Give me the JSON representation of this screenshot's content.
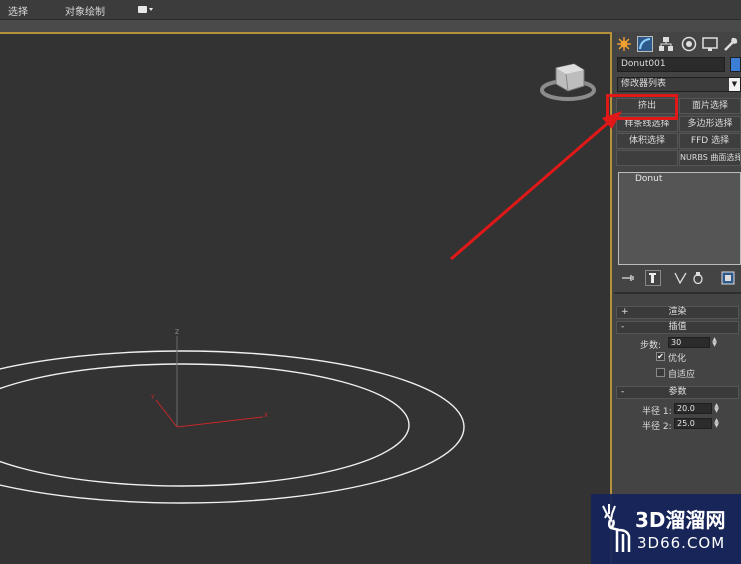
{
  "toolbar": {
    "select_label": "选择",
    "object_paint_label": "对象绘制"
  },
  "viewport": {
    "axis_z": "Z",
    "axis_x": "X",
    "axis_y": "Y"
  },
  "command_panel": {
    "tabs": [
      "create-icon",
      "modify-icon",
      "hierarchy-icon",
      "motion-icon",
      "display-icon",
      "utilities-icon"
    ],
    "object_name": "Donut001",
    "object_color": "#3a7fd5",
    "modifier_list": "修改器列表",
    "modifier_buttons": [
      "挤出",
      "面片选择",
      "样条线选择",
      "多边形选择",
      "体积选择",
      "FFD 选择",
      "",
      "NURBS 曲面选择"
    ],
    "stack_item": "Donut",
    "rollouts": {
      "rendering": {
        "sign": "+",
        "title": "渲染"
      },
      "interpolation": {
        "sign": "-",
        "title": "插值",
        "steps_label": "步数:",
        "steps_value": "30",
        "optimize_label": "优化",
        "optimize_checked": true,
        "adaptive_label": "自适应",
        "adaptive_checked": false
      },
      "parameters": {
        "sign": "-",
        "title": "参数",
        "radius1_label": "半径 1:",
        "radius1_value": "20.0",
        "radius2_label": "半径 2:",
        "radius2_value": "25.0"
      }
    }
  },
  "annotation": {
    "color": "#e01818"
  },
  "watermark": {
    "main": "3D溜溜网",
    "sub": "3D66.COM"
  }
}
